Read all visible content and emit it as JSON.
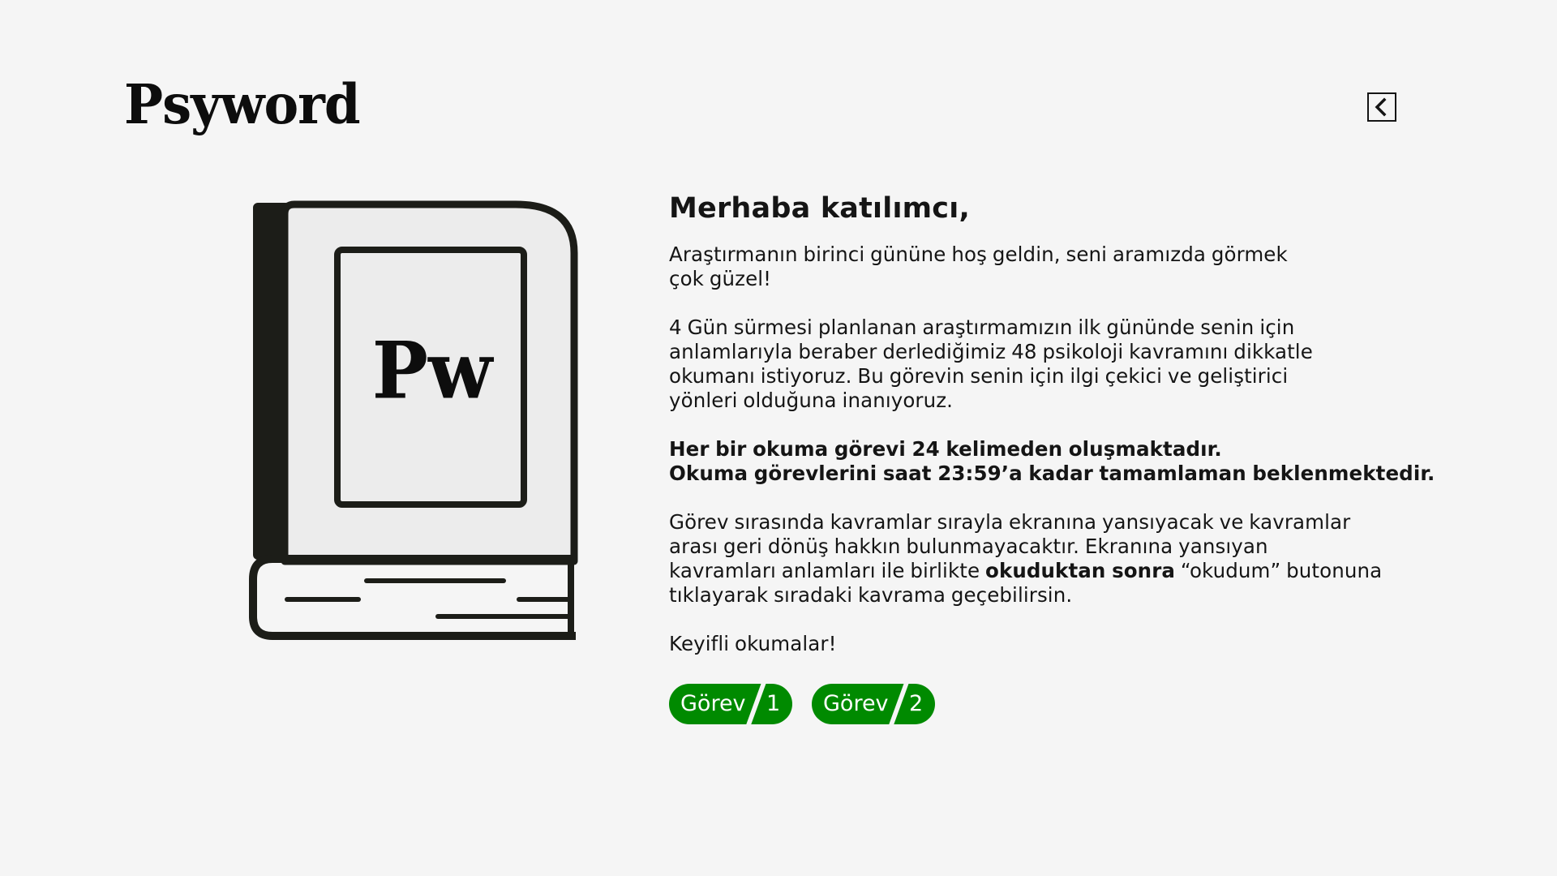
{
  "header": {
    "logo_text": "Psyword",
    "back_icon": "chevron-left-icon"
  },
  "illustration": {
    "book_icon": "book-icon",
    "monogram": "Pw"
  },
  "content": {
    "greeting": "Merhaba katılımcı,",
    "p1": [
      "Araştırmanın birinci gününe hoş geldin, seni aramızda görmek",
      "çok güzel!"
    ],
    "p2": [
      "4 Gün sürmesi planlanan araştırmamızın ilk gününde senin için",
      "anlamlarıyla beraber derlediğimiz 48 psikoloji kavramını dikkatle",
      "okumanı istiyoruz. Bu görevin senin için ilgi çekici ve geliştirici",
      "yönleri olduğuna inanıyoruz."
    ],
    "p3": [
      "Her bir okuma görevi 24 kelimeden oluşmaktadır.",
      "Okuma görevlerini saat 23:59’a kadar tamamlaman beklenmektedir."
    ],
    "p4_lines": {
      "l1": "Görev sırasında kavramlar sırayla ekranına yansıyacak ve kavramlar",
      "l2": "arası geri dönüş hakkın bulunmayacaktır. Ekranına yansıyan",
      "l3_pre": "kavramları anlamları ile birlikte ",
      "l3_bold": "okuduktan sonra",
      "l3_post": " “okudum” butonuna",
      "l4": "tıklayarak sıradaki kavrama geçebilirsin."
    },
    "p5": "Keyifli okumalar!"
  },
  "tasks": [
    {
      "label": "Görev",
      "number": "1"
    },
    {
      "label": "Görev",
      "number": "2"
    }
  ],
  "colors": {
    "background": "#f5f5f5",
    "text": "#151515",
    "accent_green": "#008a00"
  }
}
